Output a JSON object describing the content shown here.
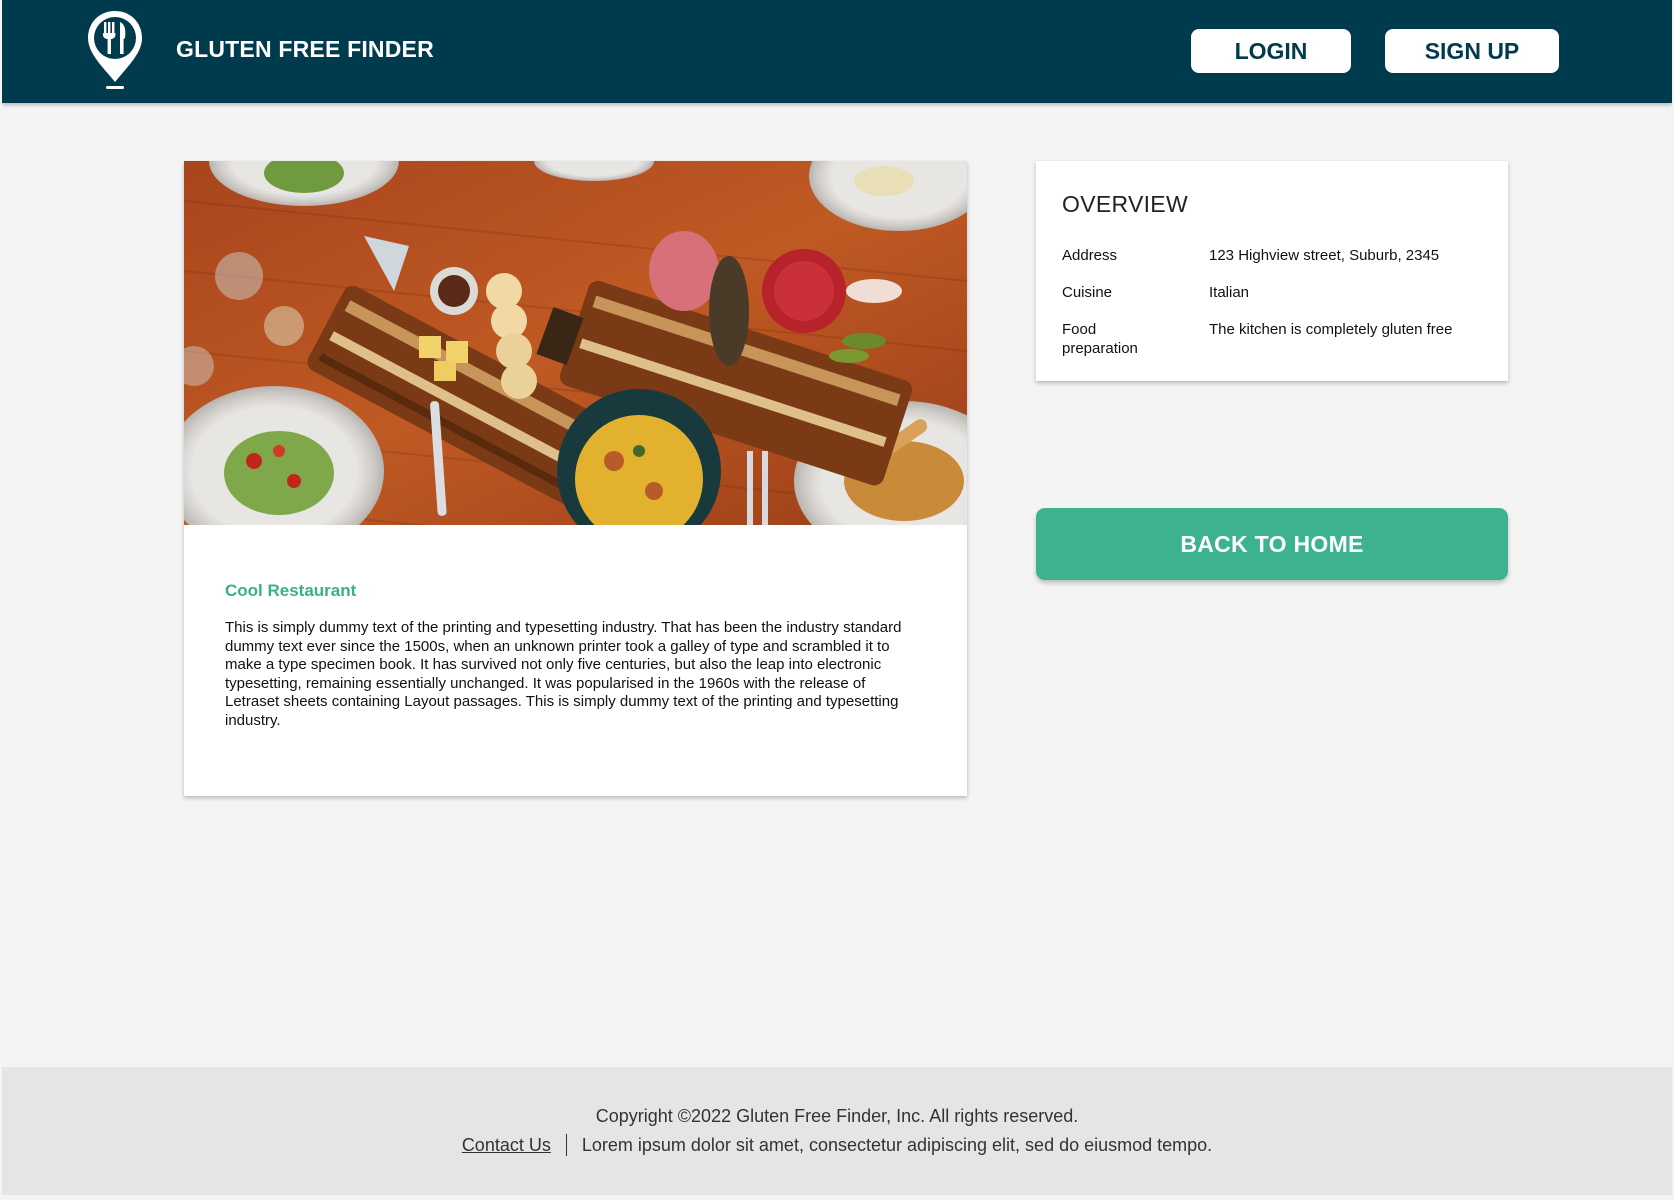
{
  "header": {
    "brand": "GLUTEN FREE FINDER",
    "login_label": "LOGIN",
    "signup_label": "SIGN UP",
    "logo_icon": "fork-knife-map-pin-icon"
  },
  "restaurant": {
    "name": "Cool Restaurant",
    "description": "This is simply dummy text of the printing and typesetting industry. That has been the industry standard dummy text ever since the 1500s, when an unknown printer took a galley of type and scrambled it to make a type specimen book. It has survived not only five centuries, but also the leap into electronic typesetting, remaining essentially unchanged. It was popularised in the 1960s with the release of Letraset sheets containing Layout passages. This is simply dummy text of the printing and typesetting industry."
  },
  "overview": {
    "title": "OVERVIEW",
    "rows": [
      {
        "label": "Address",
        "value": "123 Highview street, Suburb, 2345"
      },
      {
        "label": "Cuisine",
        "value": "Italian"
      },
      {
        "label": "Food preparation",
        "value": "The kitchen is completely gluten free"
      }
    ]
  },
  "actions": {
    "back_label": "BACK TO HOME"
  },
  "footer": {
    "copyright": "Copyright ©2022 Gluten Free Finder, Inc. All rights reserved.",
    "contact_label": "Contact Us",
    "tagline": "Lorem ipsum dolor sit amet, consectetur adipiscing elit, sed do eiusmod tempo."
  },
  "colors": {
    "header_bg": "#003a4d",
    "accent": "#3cb291",
    "page_bg": "#f4f4f4",
    "footer_bg": "#e5e5e5"
  }
}
